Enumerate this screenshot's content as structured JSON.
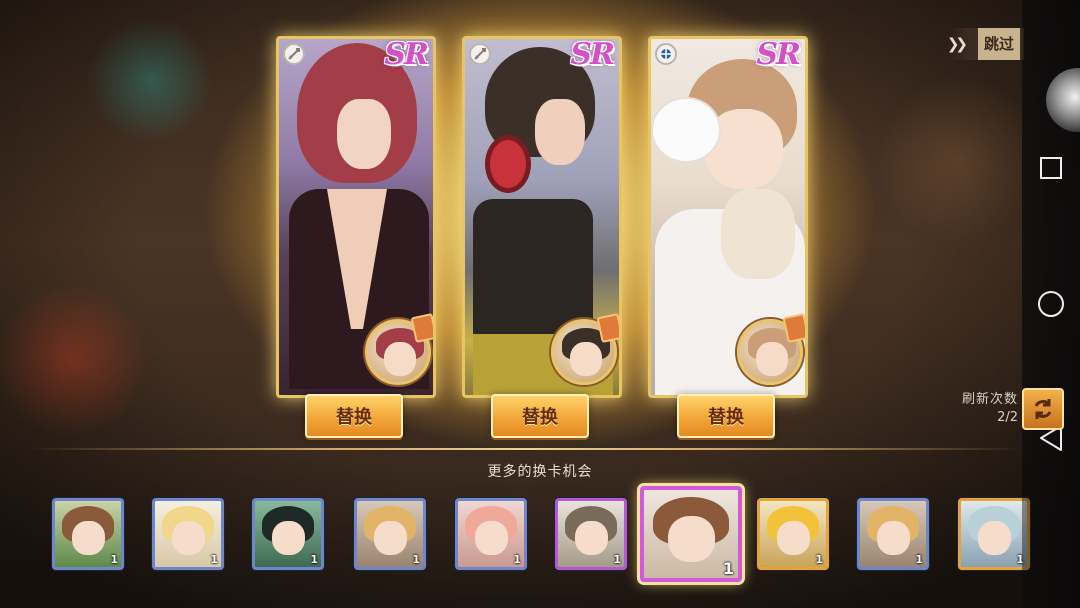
{
  "cards": [
    {
      "id": 1,
      "rarity": "SR",
      "swap_label": "替换",
      "corner_icon": "sword-icon"
    },
    {
      "id": 2,
      "rarity": "SR",
      "swap_label": "替换",
      "corner_icon": "sword-icon"
    },
    {
      "id": 3,
      "rarity": "SR",
      "swap_label": "替换",
      "corner_icon": "badge-icon"
    }
  ],
  "more_cards_label": "更多的换卡机会",
  "skip": {
    "arrows": "❯❯",
    "label": "跳过"
  },
  "refresh": {
    "label": "刷新次数",
    "count": "2/2"
  },
  "strip": [
    {
      "count": "1",
      "rarity": "blue"
    },
    {
      "count": "1",
      "rarity": "blue"
    },
    {
      "count": "1",
      "rarity": "blue"
    },
    {
      "count": "1",
      "rarity": "blue"
    },
    {
      "count": "1",
      "rarity": "blue"
    },
    {
      "count": "1",
      "rarity": "purple"
    },
    {
      "count": "1",
      "rarity": "purple",
      "selected": true
    },
    {
      "count": "1",
      "rarity": "orange"
    },
    {
      "count": "1",
      "rarity": "blue"
    },
    {
      "count": "1",
      "rarity": "orange"
    }
  ],
  "nav": {
    "recents": "square-icon",
    "home": "circle-icon",
    "back": "triangle-back-icon"
  },
  "colors": {
    "card_border": "#e8c463",
    "sr_badge": "#d64fc8",
    "swap_button": "#f3a63a",
    "thumb_blue": "#6f86c8",
    "thumb_purple": "#b35ad0",
    "thumb_orange": "#e6a33a"
  }
}
